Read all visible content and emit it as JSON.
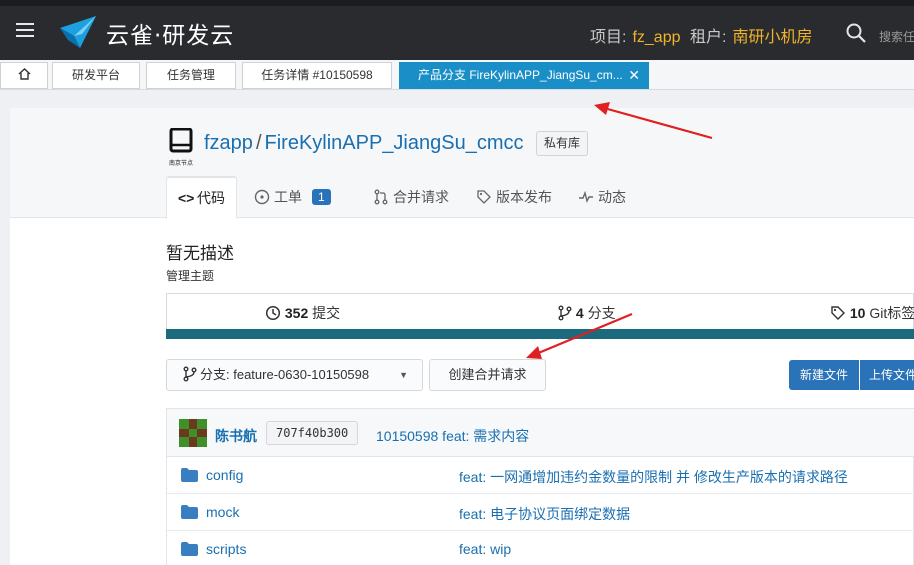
{
  "header": {
    "brand": "云雀·研发云",
    "project_label": "项目:",
    "project_value": "fz_app",
    "tenant_label": "租户:",
    "tenant_value": "南研小机房",
    "search_placeholder": "搜索任"
  },
  "tabs": [
    {
      "label": "研发平台"
    },
    {
      "label": "任务管理"
    },
    {
      "label": "任务详情 #10150598"
    },
    {
      "label": "产品分支 FireKylinAPP_JiangSu_cm...",
      "active": true
    }
  ],
  "repo": {
    "icon_caption": "南京节点",
    "owner": "fzapp",
    "separator": "/",
    "name": "FireKylinAPP_JiangSu_cmcc",
    "visibility_badge": "私有库"
  },
  "nav": {
    "code": "代码",
    "issues": "工单",
    "issues_count": "1",
    "merge_requests": "合并请求",
    "releases": "版本发布",
    "activity": "动态"
  },
  "description": "暂无描述",
  "manage_topics": "管理主题",
  "stats": {
    "commits_count": "352",
    "commits_label": "提交",
    "branches_count": "4",
    "branches_label": "分支",
    "tags_count": "10",
    "tags_label": "Git标签"
  },
  "toolbar": {
    "branch_label": "分支: feature-0630-10150598",
    "create_mr": "创建合并请求",
    "new_file": "新建文件",
    "upload_file": "上传文件"
  },
  "latest_commit": {
    "author": "陈书航",
    "sha": "707f40b300",
    "message": "10150598 feat: 需求内容"
  },
  "files": [
    {
      "name": "config",
      "message": "feat: 一网通增加违约金数量的限制 并 修改生产版本的请求路径"
    },
    {
      "name": "mock",
      "message": "feat: 电子协议页面绑定数据"
    },
    {
      "name": "scripts",
      "message": "feat: wip"
    }
  ],
  "colors": {
    "topbar": "#2a2b2e",
    "accent": "#f0b429",
    "active_tab": "#1a8ec7",
    "link": "#1a6fb0",
    "primary_button": "#2b73b8",
    "stats_bar": "#1c6a7d",
    "annotation_arrow": "#e02020"
  }
}
